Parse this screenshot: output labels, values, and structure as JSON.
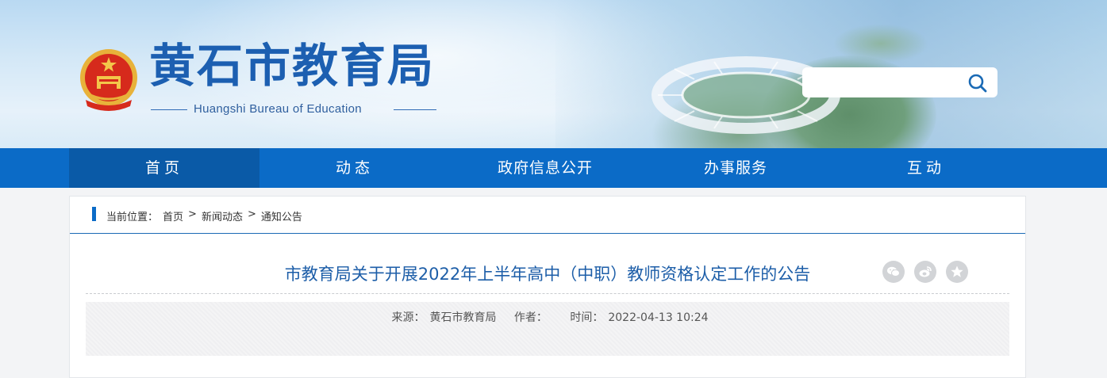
{
  "header": {
    "title": "黄石市教育局",
    "subtitle": "Huangshi Bureau of Education",
    "logo_icon": "national-emblem-icon",
    "search": {
      "placeholder": "",
      "button_icon": "search-icon"
    }
  },
  "nav": {
    "items": [
      {
        "label": "首页",
        "active": true
      },
      {
        "label": "动态"
      },
      {
        "label": "政府信息公开"
      },
      {
        "label": "办事服务"
      },
      {
        "label": "互动"
      }
    ]
  },
  "breadcrumb": {
    "prefix": "当前位置：",
    "items": [
      "首页",
      "新闻动态",
      "通知公告"
    ],
    "separator": ">"
  },
  "article": {
    "title": "市教育局关于开展2022年上半年高中（中职）教师资格认定工作的公告",
    "share_icons": [
      "wechat-icon",
      "weibo-icon",
      "favorite-star-icon"
    ],
    "meta": {
      "source_label": "来源：",
      "source_value": "黄石市教育局",
      "author_label": "作者：",
      "author_value": "",
      "time_label": "时间：",
      "time_value": "2022-04-13 10:24"
    }
  },
  "colors": {
    "brand_blue": "#0b6bc7",
    "title_blue": "#1d5ea8",
    "nav_active": "#0a5aa7"
  }
}
